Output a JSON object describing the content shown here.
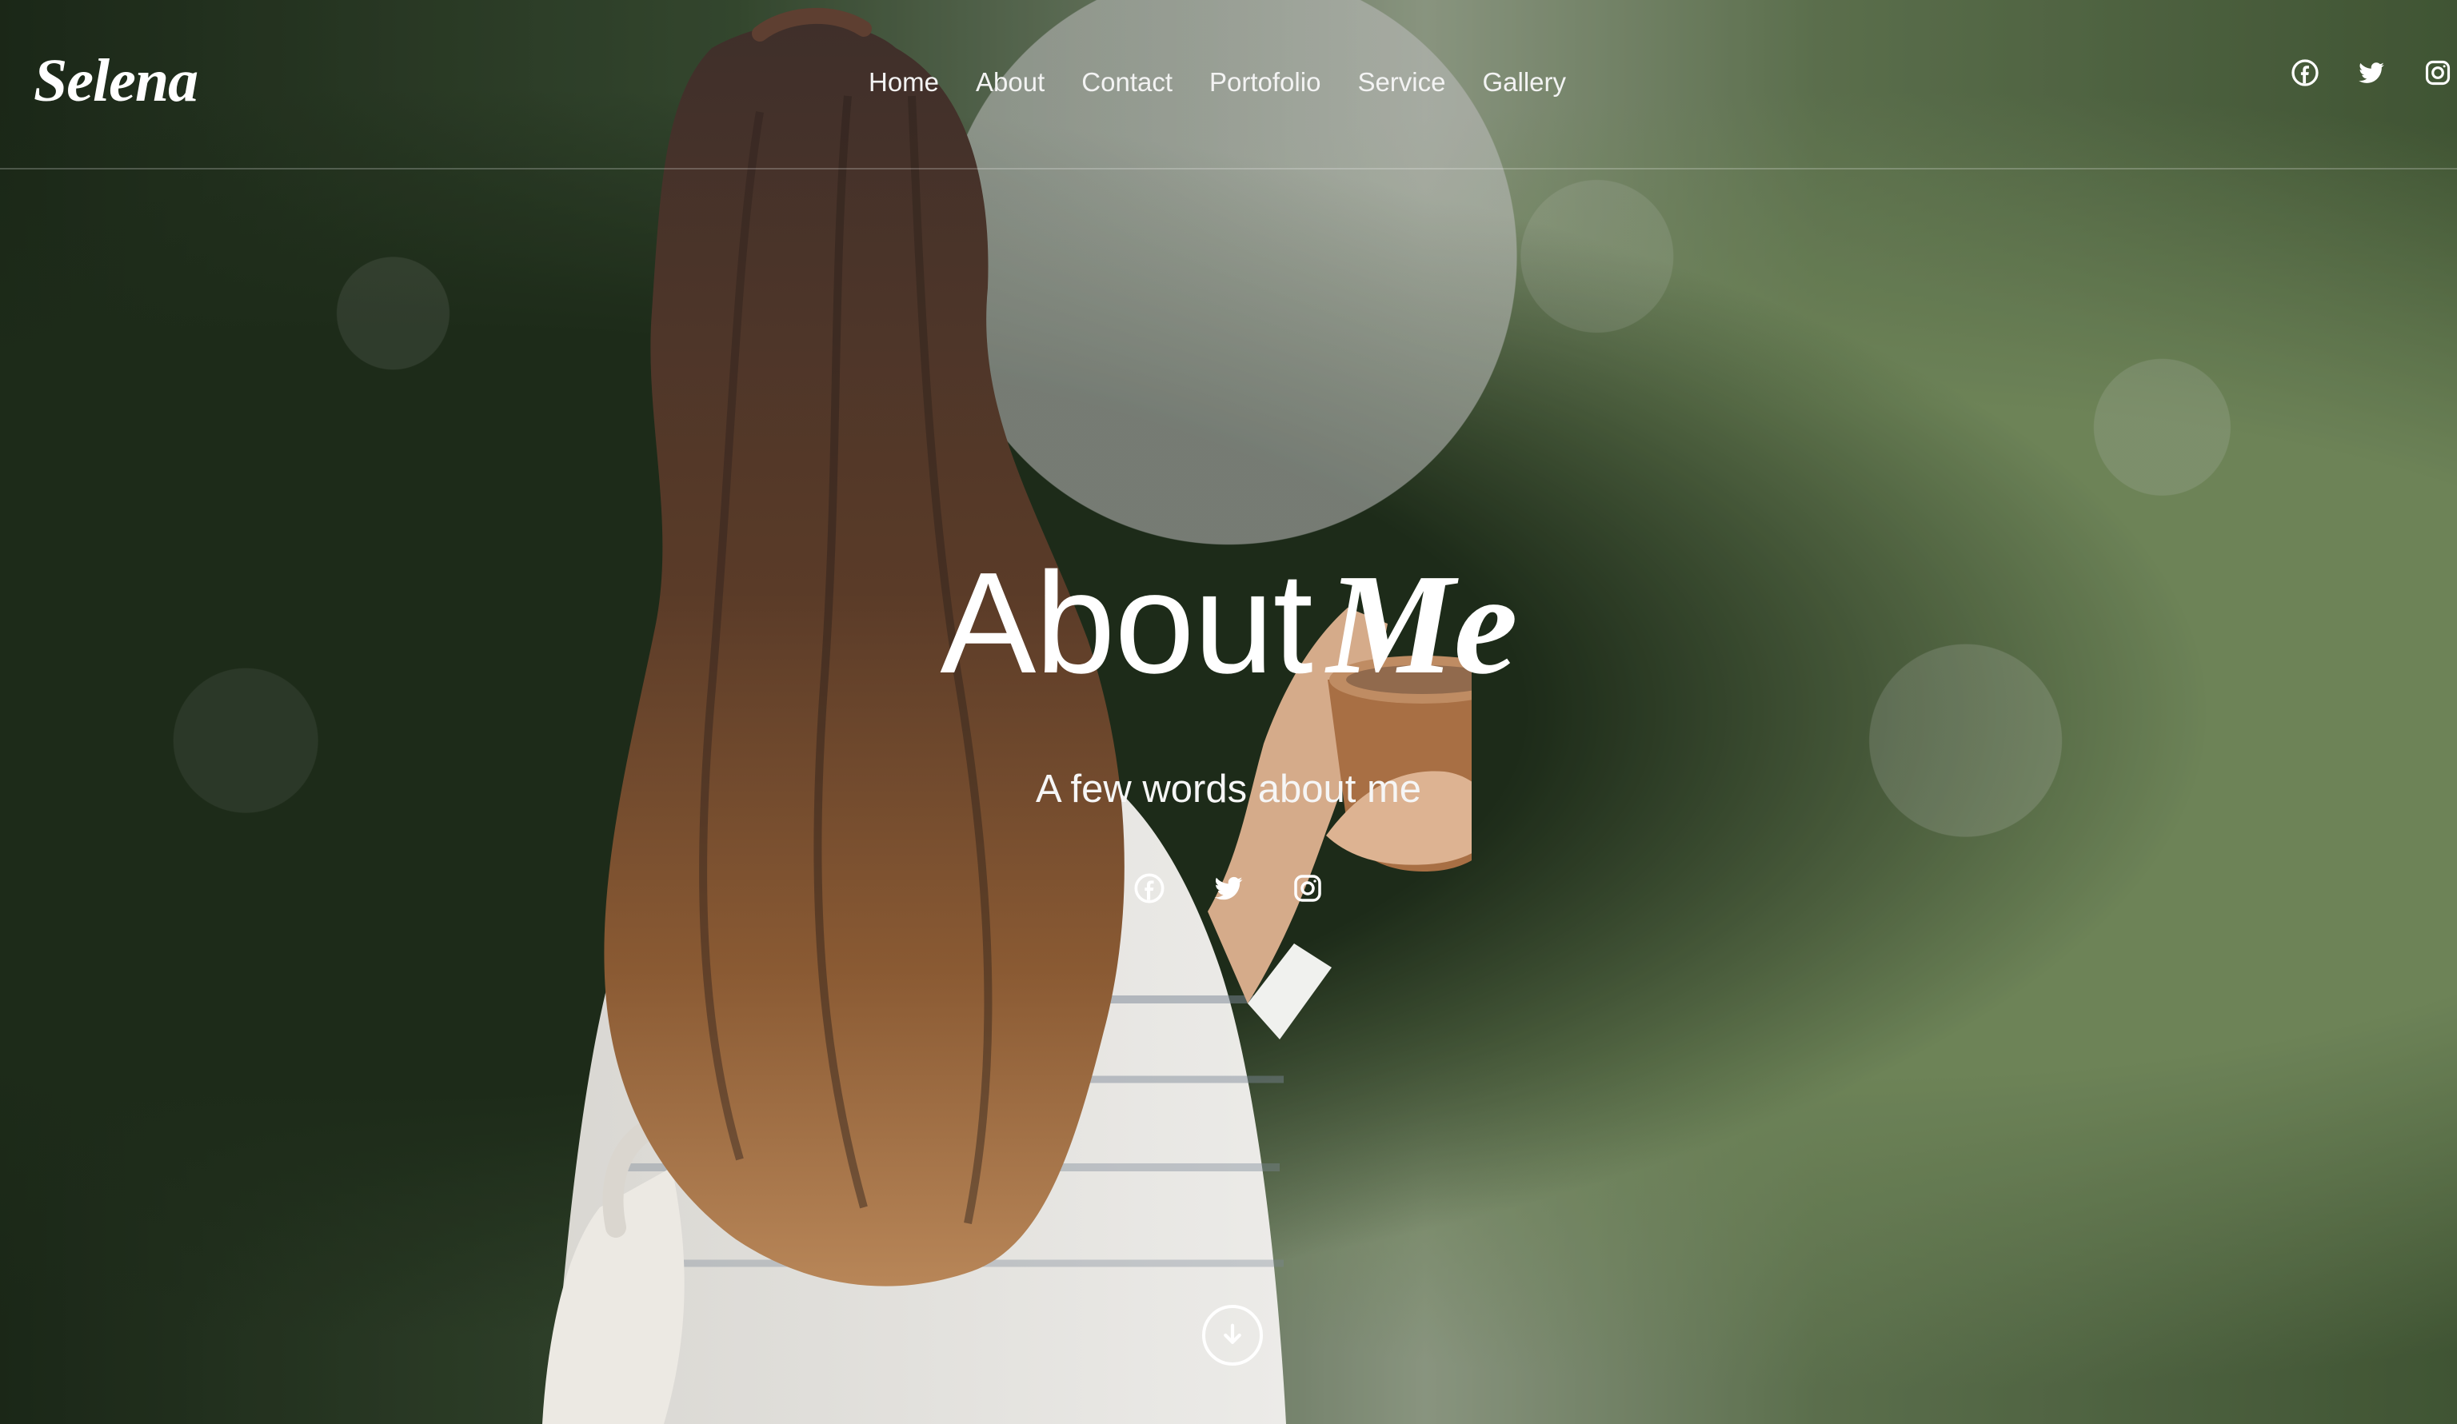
{
  "brand": {
    "logo": "Selena"
  },
  "nav": {
    "items": [
      {
        "label": "Home"
      },
      {
        "label": "About"
      },
      {
        "label": "Contact"
      },
      {
        "label": "Portofolio"
      },
      {
        "label": "Service"
      },
      {
        "label": "Gallery"
      }
    ],
    "social_icons": [
      "facebook-icon",
      "twitter-icon",
      "instagram-icon"
    ]
  },
  "hero": {
    "title_primary": "About",
    "title_accent": "Me",
    "subtitle": "A few words about me",
    "social_icons": [
      "facebook-icon",
      "twitter-icon",
      "instagram-icon"
    ],
    "scroll_icon": "arrow-down-circle-icon"
  },
  "colors": {
    "text": "#ffffff",
    "overlay": "#000000",
    "accent_foliage": "#7e9a6b"
  }
}
